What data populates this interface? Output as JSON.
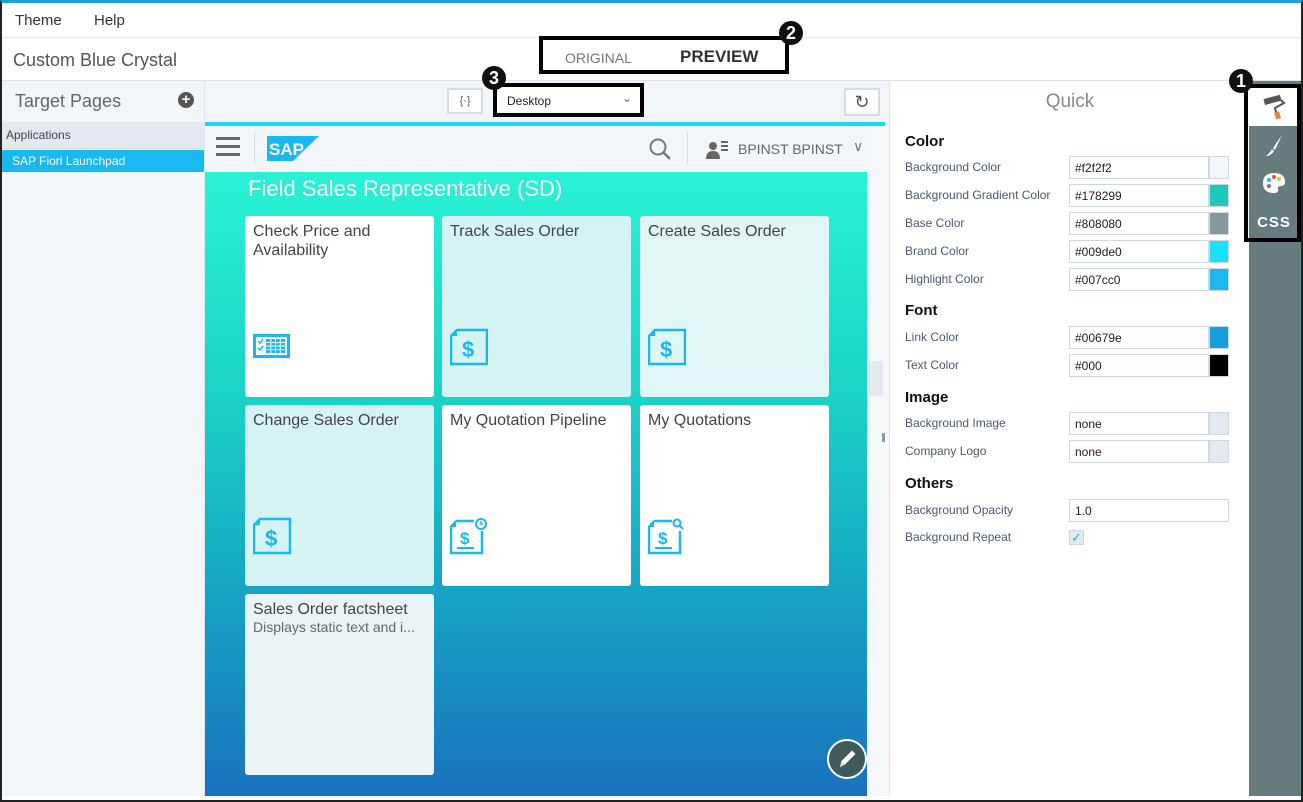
{
  "menu": {
    "items": [
      "Theme",
      "Help"
    ]
  },
  "theme": {
    "name": "Custom Blue Crystal"
  },
  "view_toggle": {
    "original": "ORIGINAL",
    "preview": "PREVIEW",
    "active": "PREVIEW"
  },
  "callouts": [
    "1",
    "2",
    "3"
  ],
  "sidebar": {
    "title": "Target Pages",
    "add_label": "+",
    "group": "Applications",
    "items": [
      {
        "label": "SAP Fiori Launchpad",
        "selected": true
      }
    ]
  },
  "preview_toolbar": {
    "fit_label": "{·}",
    "device": "Desktop",
    "device_chevron": "⌄",
    "refresh_label": "↻"
  },
  "shell": {
    "logo": "SAP",
    "user": "BPINST BPINST",
    "user_chevron": "∨"
  },
  "launchpad": {
    "group_title": "Field Sales Representative (SD)",
    "tiles": [
      {
        "title": "Check Price and Availability",
        "icon": "checklist-table-icon",
        "style": "white"
      },
      {
        "title": "Track Sales Order",
        "icon": "sales-document-icon",
        "style": "tint"
      },
      {
        "title": "Create Sales Order",
        "icon": "sales-document-icon",
        "style": "tint"
      },
      {
        "title": "Change Sales Order",
        "icon": "sales-document-icon",
        "style": "tint"
      },
      {
        "title": "My Quotation Pipeline",
        "icon": "sales-quote-clock-icon",
        "style": "white"
      },
      {
        "title": "My Quotations",
        "icon": "sales-quote-search-icon",
        "style": "white"
      },
      {
        "title": "Sales Order factsheet",
        "subtitle": "Displays static text and i...",
        "icon": "",
        "style": "pale"
      }
    ]
  },
  "quick": {
    "title": "Quick",
    "sections": {
      "color": {
        "title": "Color",
        "fields": [
          {
            "label": "Background Color",
            "value": "#f2f2f2",
            "swatch": "#f2f6f9"
          },
          {
            "label": "Background Gradient Color",
            "value": "#178299",
            "swatch": "#1ec8be"
          },
          {
            "label": "Base Color",
            "value": "#808080",
            "swatch": "#84999e"
          },
          {
            "label": "Brand Color",
            "value": "#009de0",
            "swatch": "#1ae0f8"
          },
          {
            "label": "Highlight Color",
            "value": "#007cc0",
            "swatch": "#1ab8f0"
          }
        ]
      },
      "font": {
        "title": "Font",
        "fields": [
          {
            "label": "Link Color",
            "value": "#00679e",
            "swatch": "#14a0dc"
          },
          {
            "label": "Text Color",
            "value": "#000",
            "swatch": "#000000"
          }
        ]
      },
      "image": {
        "title": "Image",
        "fields": [
          {
            "label": "Background Image",
            "value": "none",
            "swatch": "#e3e9ee"
          },
          {
            "label": "Company Logo",
            "value": "none",
            "swatch": "#e3e9ee"
          }
        ]
      },
      "others": {
        "title": "Others",
        "fields": [
          {
            "label": "Background Opacity",
            "value": "1.0"
          },
          {
            "label": "Background Repeat",
            "checked": true,
            "check_glyph": "✓"
          }
        ]
      }
    }
  },
  "rail": {
    "items": [
      "paint-roller",
      "brush",
      "palette",
      "CSS"
    ],
    "active": "paint-roller",
    "css_label": "CSS"
  }
}
